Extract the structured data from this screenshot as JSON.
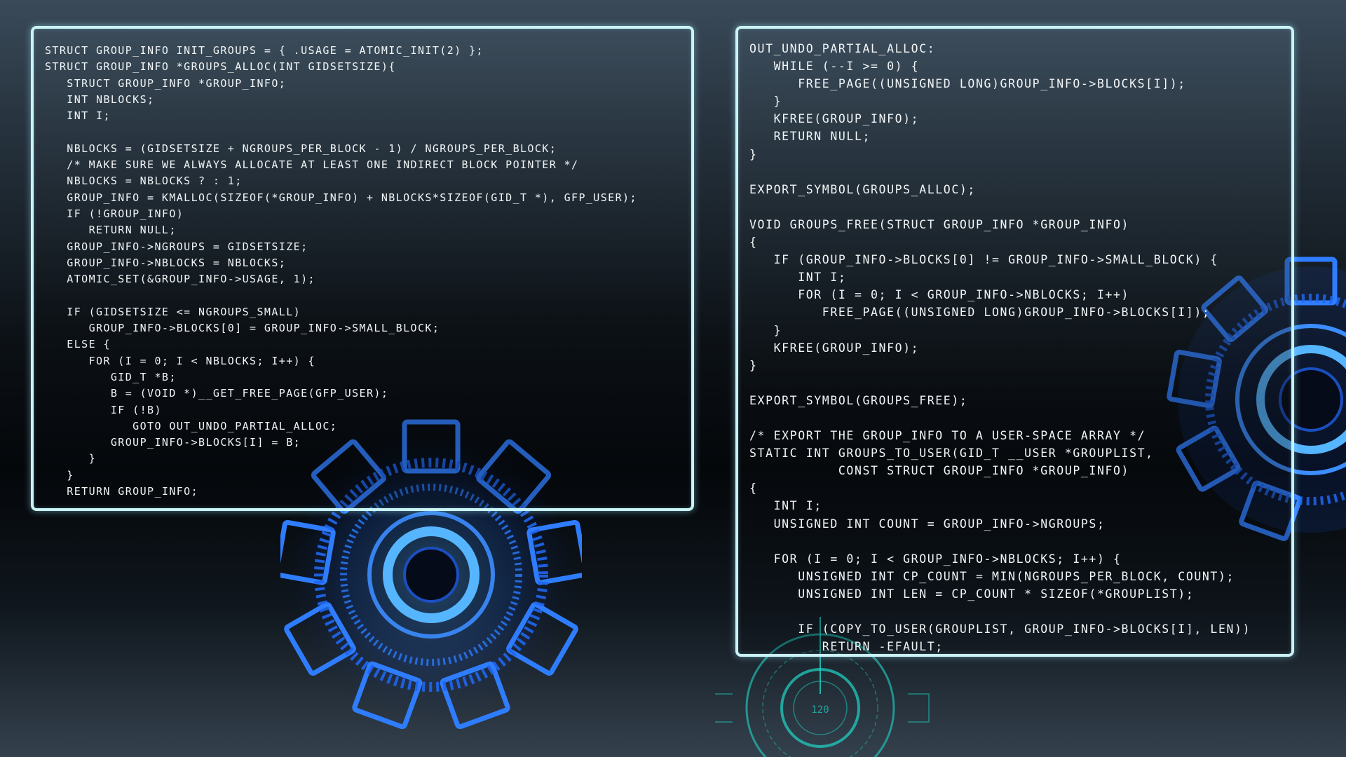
{
  "left_panel": {
    "lines": [
      "STRUCT GROUP_INFO INIT_GROUPS = { .USAGE = ATOMIC_INIT(2) };",
      "STRUCT GROUP_INFO *GROUPS_ALLOC(INT GIDSETSIZE){",
      "   STRUCT GROUP_INFO *GROUP_INFO;",
      "   INT NBLOCKS;",
      "   INT I;",
      "",
      "   NBLOCKS = (GIDSETSIZE + NGROUPS_PER_BLOCK - 1) / NGROUPS_PER_BLOCK;",
      "   /* MAKE SURE WE ALWAYS ALLOCATE AT LEAST ONE INDIRECT BLOCK POINTER */",
      "   NBLOCKS = NBLOCKS ? : 1;",
      "   GROUP_INFO = KMALLOC(SIZEOF(*GROUP_INFO) + NBLOCKS*SIZEOF(GID_T *), GFP_USER);",
      "   IF (!GROUP_INFO)",
      "      RETURN NULL;",
      "   GROUP_INFO->NGROUPS = GIDSETSIZE;",
      "   GROUP_INFO->NBLOCKS = NBLOCKS;",
      "   ATOMIC_SET(&GROUP_INFO->USAGE, 1);",
      "",
      "   IF (GIDSETSIZE <= NGROUPS_SMALL)",
      "      GROUP_INFO->BLOCKS[0] = GROUP_INFO->SMALL_BLOCK;",
      "   ELSE {",
      "      FOR (I = 0; I < NBLOCKS; I++) {",
      "         GID_T *B;",
      "         B = (VOID *)__GET_FREE_PAGE(GFP_USER);",
      "         IF (!B)",
      "            GOTO OUT_UNDO_PARTIAL_ALLOC;",
      "         GROUP_INFO->BLOCKS[I] = B;",
      "      }",
      "   }",
      "   RETURN GROUP_INFO;"
    ]
  },
  "right_panel": {
    "lines": [
      "OUT_UNDO_PARTIAL_ALLOC:",
      "   WHILE (--I >= 0) {",
      "      FREE_PAGE((UNSIGNED LONG)GROUP_INFO->BLOCKS[I]);",
      "   }",
      "   KFREE(GROUP_INFO);",
      "   RETURN NULL;",
      "}",
      "",
      "EXPORT_SYMBOL(GROUPS_ALLOC);",
      "",
      "VOID GROUPS_FREE(STRUCT GROUP_INFO *GROUP_INFO)",
      "{",
      "   IF (GROUP_INFO->BLOCKS[0] != GROUP_INFO->SMALL_BLOCK) {",
      "      INT I;",
      "      FOR (I = 0; I < GROUP_INFO->NBLOCKS; I++)",
      "         FREE_PAGE((UNSIGNED LONG)GROUP_INFO->BLOCKS[I]);",
      "   }",
      "   KFREE(GROUP_INFO);",
      "}",
      "",
      "EXPORT_SYMBOL(GROUPS_FREE);",
      "",
      "/* EXPORT THE GROUP_INFO TO A USER-SPACE ARRAY */",
      "STATIC INT GROUPS_TO_USER(GID_T __USER *GROUPLIST,",
      "           CONST STRUCT GROUP_INFO *GROUP_INFO)",
      "{",
      "   INT I;",
      "   UNSIGNED INT COUNT = GROUP_INFO->NGROUPS;",
      "",
      "   FOR (I = 0; I < GROUP_INFO->NBLOCKS; I++) {",
      "      UNSIGNED INT CP_COUNT = MIN(NGROUPS_PER_BLOCK, COUNT);",
      "      UNSIGNED INT LEN = CP_COUNT * SIZEOF(*GROUPLIST);",
      "",
      "      IF (COPY_TO_USER(GROUPLIST, GROUP_INFO->BLOCKS[I], LEN))",
      "         RETURN -EFAULT;"
    ]
  },
  "hud": {
    "dial_value": "120"
  },
  "colors": {
    "panel_border": "#c9f3f7",
    "code_text": "#f1f5f7",
    "gear_blue": "#1e6bff",
    "hud_cyan": "#1fd6c8"
  },
  "icons": [
    "gear-icon",
    "hud-dial-icon"
  ]
}
